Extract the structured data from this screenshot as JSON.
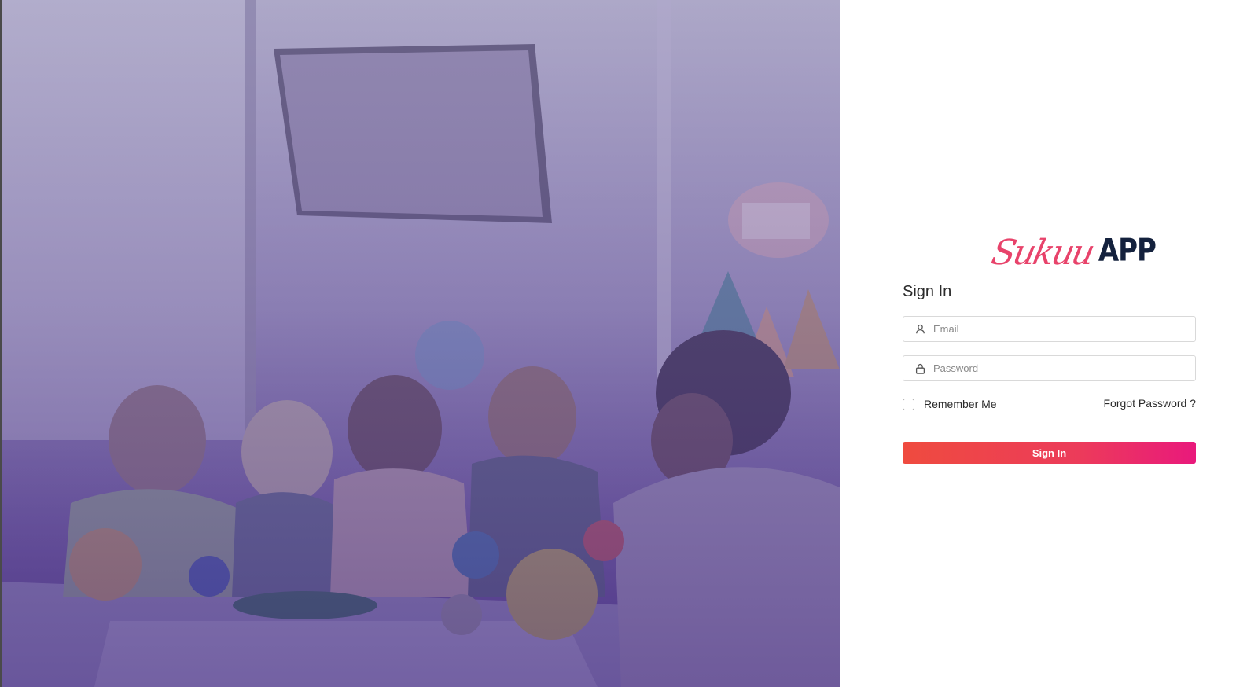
{
  "brand": {
    "script_text": "Sukuu",
    "bold_text": "APP",
    "script_color": "#e8436b",
    "bold_color": "#14213d"
  },
  "hero": {
    "description_icon": "classroom-photo"
  },
  "form": {
    "title": "Sign In",
    "email": {
      "placeholder": "Email",
      "value": "",
      "icon": "user-icon"
    },
    "password": {
      "placeholder": "Password",
      "value": "",
      "icon": "lock-icon"
    },
    "remember_label": "Remember Me",
    "remember_checked": false,
    "forgot_label": "Forgot Password ?",
    "submit_label": "Sign In"
  },
  "colors": {
    "button_gradient_start": "#ef4b3f",
    "button_gradient_end": "#e9197c"
  }
}
